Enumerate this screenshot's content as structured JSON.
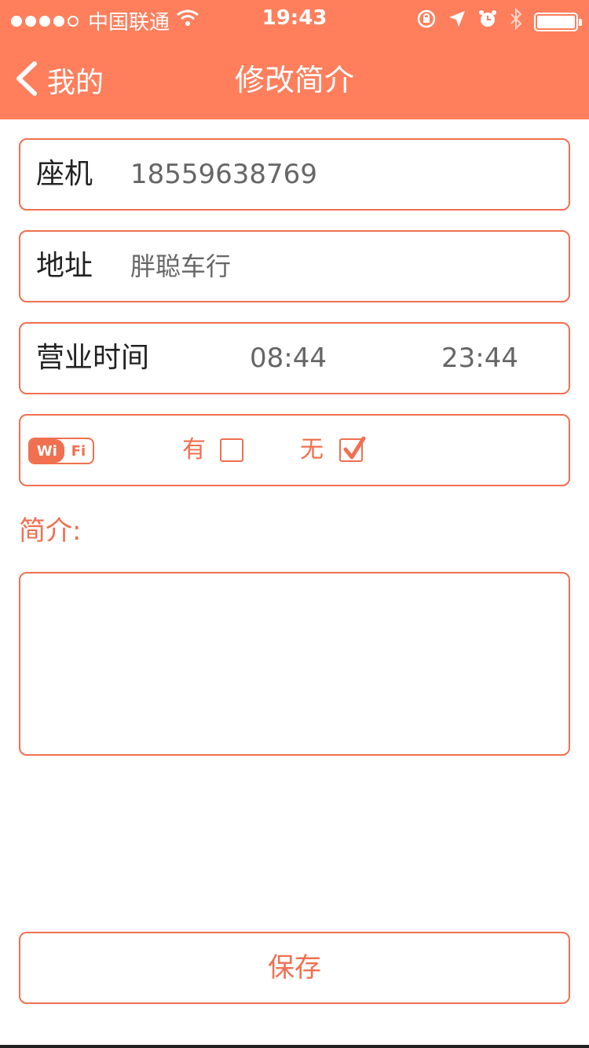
{
  "status_bar": {
    "carrier": "中国联通",
    "time": "19:43"
  },
  "nav": {
    "back_label": "我的",
    "title": "修改简介"
  },
  "form": {
    "phone": {
      "label": "座机",
      "value": "18559638769"
    },
    "address": {
      "label": "地址",
      "value": "胖聪车行"
    },
    "hours": {
      "label": "营业时间",
      "start": "08:44",
      "end": "23:44"
    },
    "wifi": {
      "badge_left": "Wi",
      "badge_right": "Fi",
      "yes_label": "有",
      "no_label": "无",
      "yes_checked": false,
      "no_checked": true
    },
    "intro": {
      "label": "简介:",
      "value": ""
    }
  },
  "actions": {
    "save_label": "保存"
  },
  "colors": {
    "accent": "#FF7F5D",
    "border": "#F07050"
  }
}
